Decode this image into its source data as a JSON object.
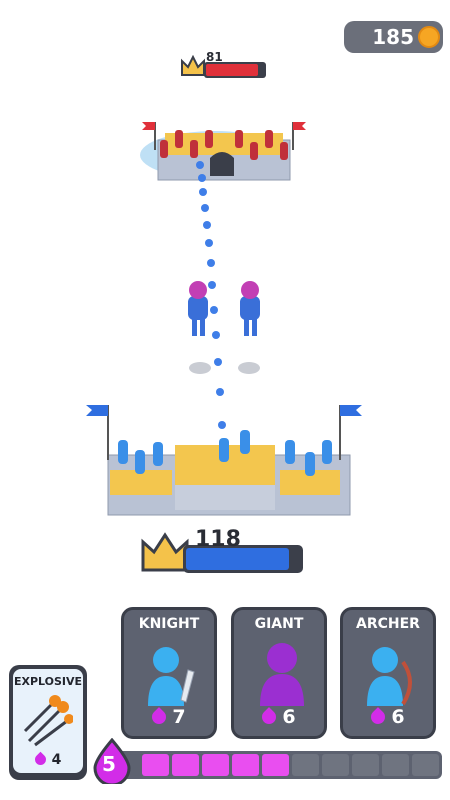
{
  "hud": {
    "coins": "185",
    "enemy_hp": "81",
    "enemy_hp_fraction": 0.9,
    "player_hp": "118",
    "player_hp_fraction": 0.9
  },
  "cards": [
    {
      "name": "KNIGHT",
      "cost": "7"
    },
    {
      "name": "GIANT",
      "cost": "6"
    },
    {
      "name": "ARCHER",
      "cost": "6"
    }
  ],
  "spell": {
    "name": "EXPLOSIVE",
    "cost": "4"
  },
  "mana": {
    "count": "5",
    "filled": 5,
    "total": 10
  },
  "colors": {
    "player": "#2f6ee0",
    "enemy": "#e0303a",
    "mana": "#e94ef0",
    "card_bg": "#5d6270",
    "gold": "#f4c24a"
  }
}
